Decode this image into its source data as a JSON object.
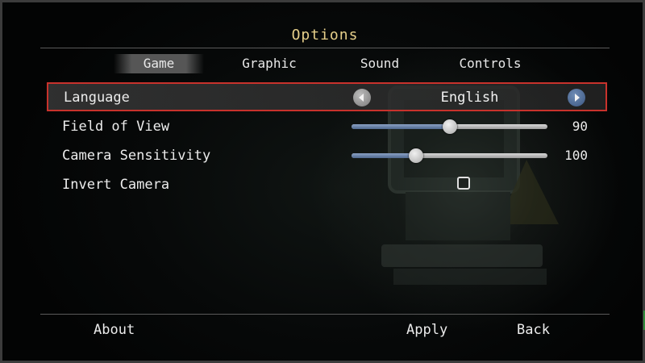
{
  "title": "Options",
  "tabs": [
    {
      "label": "Game",
      "active": true
    },
    {
      "label": "Graphic",
      "active": false
    },
    {
      "label": "Sound",
      "active": false
    },
    {
      "label": "Controls",
      "active": false
    }
  ],
  "settings": {
    "language": {
      "label": "Language",
      "value": "English",
      "selected": true
    },
    "field_of_view": {
      "label": "Field of View",
      "value": "90",
      "level": 0.5
    },
    "camera_sensitivity": {
      "label": "Camera Sensitivity",
      "value": "100",
      "level": 0.33
    },
    "invert_camera": {
      "label": "Invert Camera",
      "checked": false
    }
  },
  "footer": {
    "about_label": "About",
    "apply_label": "Apply",
    "back_label": "Back"
  },
  "colors": {
    "title": "#e6cf8a",
    "selection_border": "#c8322c",
    "slider_fill": "#50698f",
    "right_arrow": "#3b5680"
  },
  "icons": {
    "left_arrow": "arrow-left-icon",
    "right_arrow": "arrow-right-icon"
  }
}
